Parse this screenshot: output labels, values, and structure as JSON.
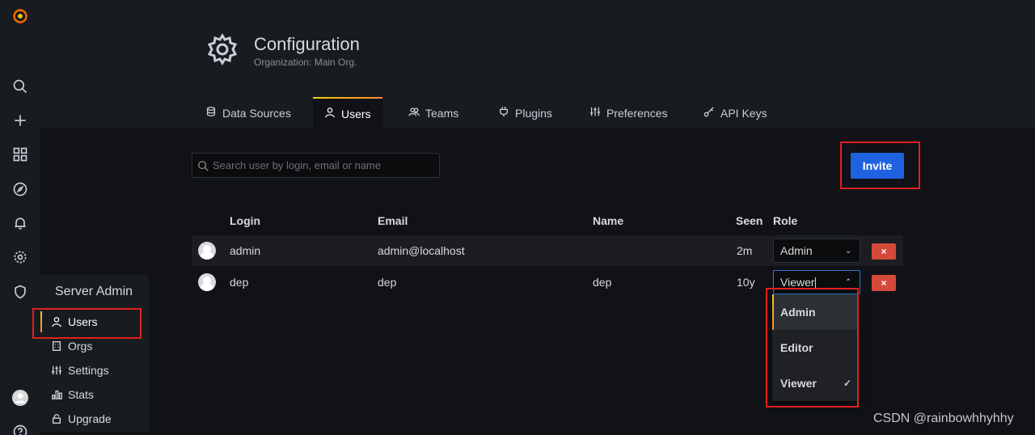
{
  "sidebar": {
    "icons": [
      "grafana-logo-icon",
      "search-icon",
      "plus-icon",
      "dashboards-icon",
      "explore-icon",
      "alerting-icon",
      "gear-icon",
      "shield-icon",
      "user-avatar",
      "help-icon"
    ]
  },
  "server_admin": {
    "title": "Server Admin",
    "items": [
      {
        "label": "Users",
        "icon": "user-icon",
        "active": true
      },
      {
        "label": "Orgs",
        "icon": "building-icon"
      },
      {
        "label": "Settings",
        "icon": "sliders-icon"
      },
      {
        "label": "Stats",
        "icon": "bar-chart-icon"
      },
      {
        "label": "Upgrade",
        "icon": "lock-icon"
      }
    ]
  },
  "header": {
    "title": "Configuration",
    "subtitle": "Organization: Main Org."
  },
  "tabs": [
    {
      "label": "Data Sources",
      "icon": "database-icon"
    },
    {
      "label": "Users",
      "icon": "user-icon",
      "active": true
    },
    {
      "label": "Teams",
      "icon": "users-icon"
    },
    {
      "label": "Plugins",
      "icon": "plug-icon"
    },
    {
      "label": "Preferences",
      "icon": "sliders-icon"
    },
    {
      "label": "API Keys",
      "icon": "key-icon"
    }
  ],
  "search": {
    "placeholder": "Search user by login, email or name",
    "value": ""
  },
  "invite_button": "Invite",
  "table": {
    "headers": {
      "login": "Login",
      "email": "Email",
      "name": "Name",
      "seen": "Seen",
      "role": "Role"
    },
    "rows": [
      {
        "login": "admin",
        "email": "admin@localhost",
        "name": "",
        "seen": "2m",
        "role": "Admin"
      },
      {
        "login": "dep",
        "email": "dep",
        "name": "dep",
        "seen": "10y",
        "role": "Viewer"
      }
    ],
    "delete_label": "×"
  },
  "role_dropdown": {
    "options": [
      "Admin",
      "Editor",
      "Viewer"
    ],
    "selected": "Viewer",
    "highlighted": "Admin"
  },
  "watermark": "CSDN @rainbowhhyhhy",
  "colors": {
    "primary": "#1f62e0",
    "danger": "#d44a3a",
    "highlight_box": "#e02020",
    "accent_gradient": [
      "#f2cc0c",
      "#ff8833"
    ]
  }
}
